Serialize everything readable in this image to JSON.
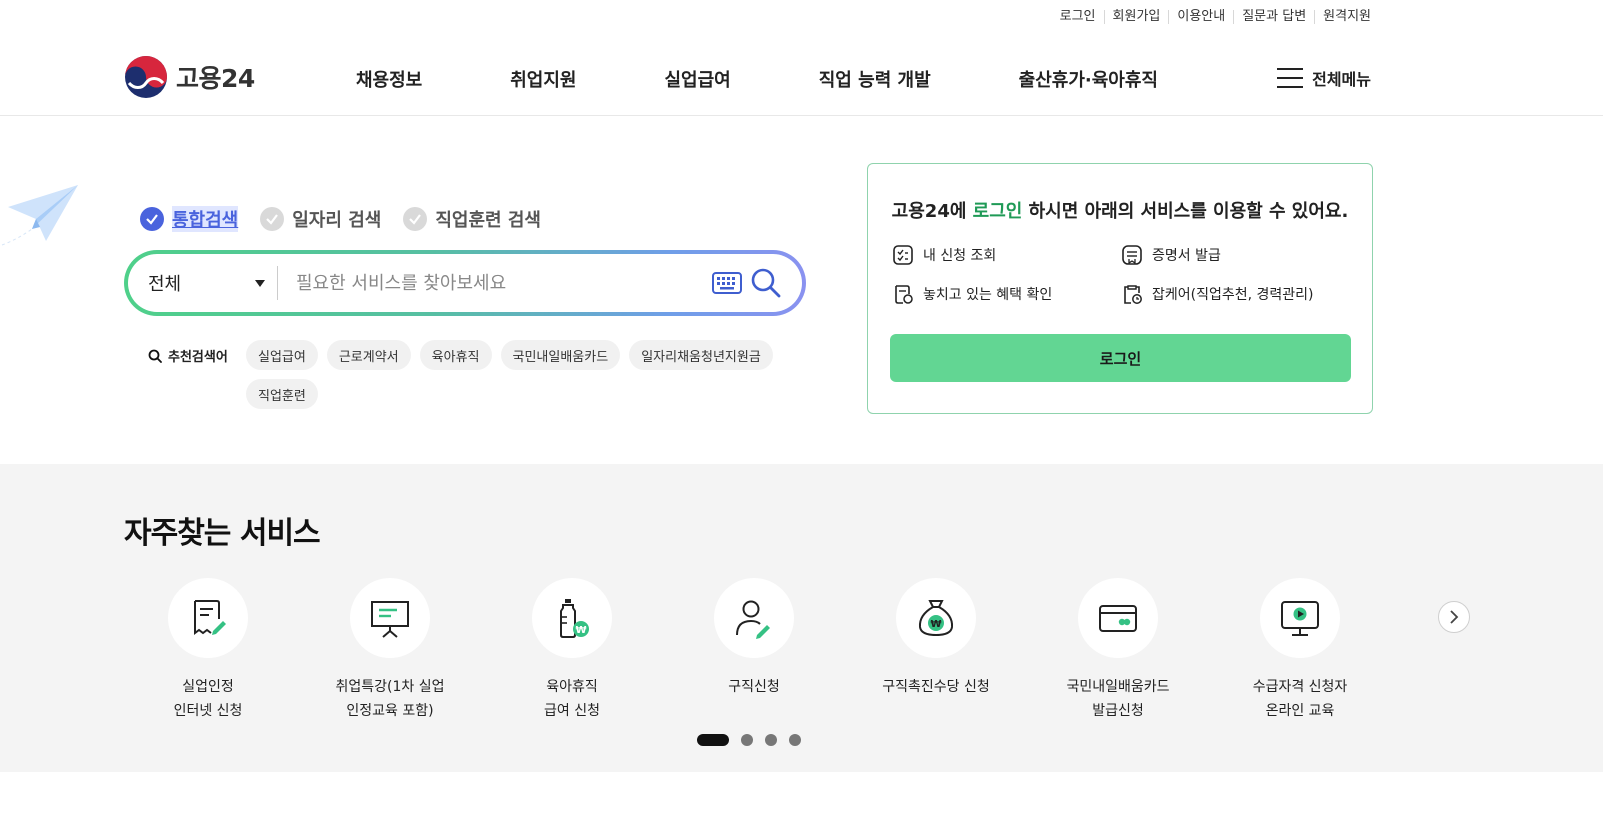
{
  "util_links": [
    "로그인",
    "회원가입",
    "이용안내",
    "질문과 답변",
    "원격지원"
  ],
  "logo": {
    "text": "고용24",
    "icon": "taegeuk-icon"
  },
  "gnb": [
    "채용정보",
    "취업지원",
    "실업급여",
    "직업 능력 개발",
    "출산휴가·육아휴직"
  ],
  "all_menu": "전체메뉴",
  "search": {
    "tabs": [
      {
        "label": "통합검색",
        "active": true
      },
      {
        "label": "일자리 검색",
        "active": false
      },
      {
        "label": "직업훈련 검색",
        "active": false
      }
    ],
    "select": "전체",
    "placeholder": "필요한 서비스를 찾아보세요",
    "recommend_label": "추천검색어",
    "recommended": [
      "실업급여",
      "근로계약서",
      "육아휴직",
      "국민내일배움카드",
      "일자리채움청년지원금",
      "직업훈련"
    ]
  },
  "login_card": {
    "title_pre": "고용24에 ",
    "title_hl": "로그인",
    "title_post": " 하시면 아래의 서비스를 이용할 수 있어요.",
    "items": [
      "내 신청 조회",
      "증명서 발급",
      "놓치고 있는 혜택 확인",
      "잡케어(직업추천, 경력관리)"
    ],
    "button": "로그인",
    "accent": "#1f9a56",
    "button_color": "#62d693"
  },
  "freq": {
    "title": "자주찾는 서비스",
    "services": [
      {
        "label": "실업인정\n인터넷 신청",
        "icon": "document-pen-icon"
      },
      {
        "label": "취업특강(1차 실업\n인정교육 포함)",
        "icon": "presentation-board-icon"
      },
      {
        "label": "육아휴직\n급여 신청",
        "icon": "baby-bottle-icon"
      },
      {
        "label": "구직신청",
        "icon": "person-pen-icon"
      },
      {
        "label": "구직촉진수당 신청",
        "icon": "money-bag-icon"
      },
      {
        "label": "국민내일배움카드\n발급신청",
        "icon": "card-icon"
      },
      {
        "label": "수급자격 신청자\n온라인 교육",
        "icon": "monitor-play-icon"
      }
    ],
    "pagination": {
      "current": 1,
      "total": 4
    }
  }
}
